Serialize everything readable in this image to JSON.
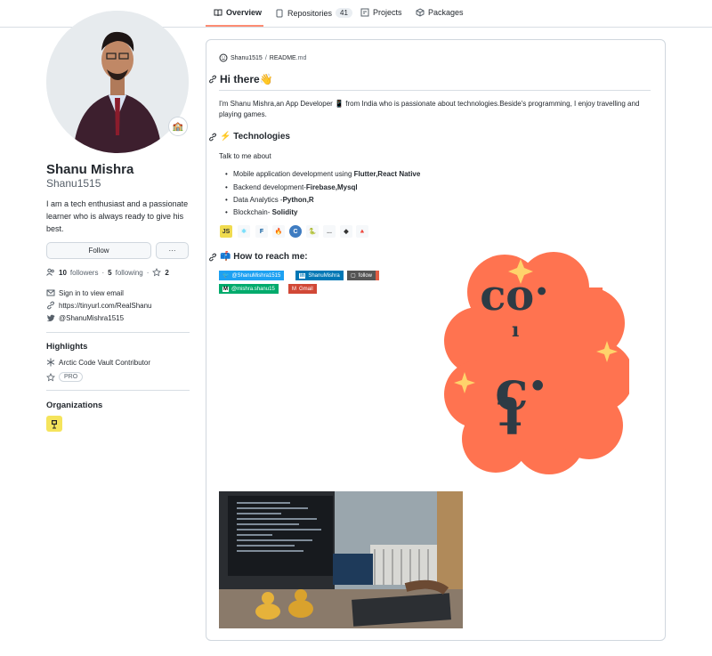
{
  "tabs": [
    {
      "label": "Overview",
      "icon": "book-icon",
      "active": true
    },
    {
      "label": "Repositories",
      "icon": "repo-icon",
      "count": "41"
    },
    {
      "label": "Projects",
      "icon": "project-icon"
    },
    {
      "label": "Packages",
      "icon": "package-icon"
    }
  ],
  "profile": {
    "name": "Shanu Mishra",
    "login": "Shanu1515",
    "bio": "I am a tech enthusiast and a passionate learner who is always ready to give his best.",
    "status_emoji": "🏫",
    "follow_label": "Follow",
    "more_label": "···",
    "followers_count": "10",
    "followers_label": "followers",
    "sep": "·",
    "following_count": "5",
    "following_label": "following",
    "stars_sep": "·",
    "stars_count": "2",
    "email": "Sign in to view email",
    "website": "https://tinyurl.com/RealShanu",
    "twitter": "@ShanuMishra1515"
  },
  "highlights": {
    "title": "Highlights",
    "arctic": "Arctic Code Vault Contributor",
    "pro": "PRO"
  },
  "organizations": {
    "title": "Organizations"
  },
  "readme": {
    "owner": "Shanu1515",
    "slash": "/",
    "file": "README",
    "ext": ".md",
    "heading": "Hi there👋",
    "intro": "I'm Shanu Mishra,an App Developer 📱 from India who is passionate about technologies.Beside's programming, I enjoy travelling and playing games.",
    "tech_heading": "⚡ Technologies",
    "talk": "Talk to me about",
    "items": [
      {
        "text": "Mobile application development using ",
        "bold": "Flutter,React Native"
      },
      {
        "text": "Backend development-",
        "bold": "Firebase,Mysql"
      },
      {
        "text": "Data Analytics -",
        "bold": "Python,R"
      },
      {
        "text": "Blockchain- ",
        "bold": "Solidity"
      }
    ],
    "reach_heading": "📫 How to reach me:",
    "badges": [
      {
        "label": "@ShanuMishra1515",
        "color": "#1da1f2",
        "icon": "twitter-icon"
      },
      {
        "label": "ShanuMishra",
        "color": "#0077b5",
        "icon": "linkedin-icon"
      },
      {
        "label": "follow",
        "color": "#555555",
        "icon": "follow-icon"
      },
      {
        "label": "@mishra.shanu15",
        "color": "#00ab6c",
        "icon": "medium-icon"
      },
      {
        "label": "Gmail",
        "color": "#d14836",
        "icon": "gmail-icon"
      }
    ],
    "tech_icons": [
      "JS",
      "⚛",
      "F",
      "🔥",
      "C",
      "🐍",
      "...",
      "◆",
      "🔺"
    ]
  }
}
